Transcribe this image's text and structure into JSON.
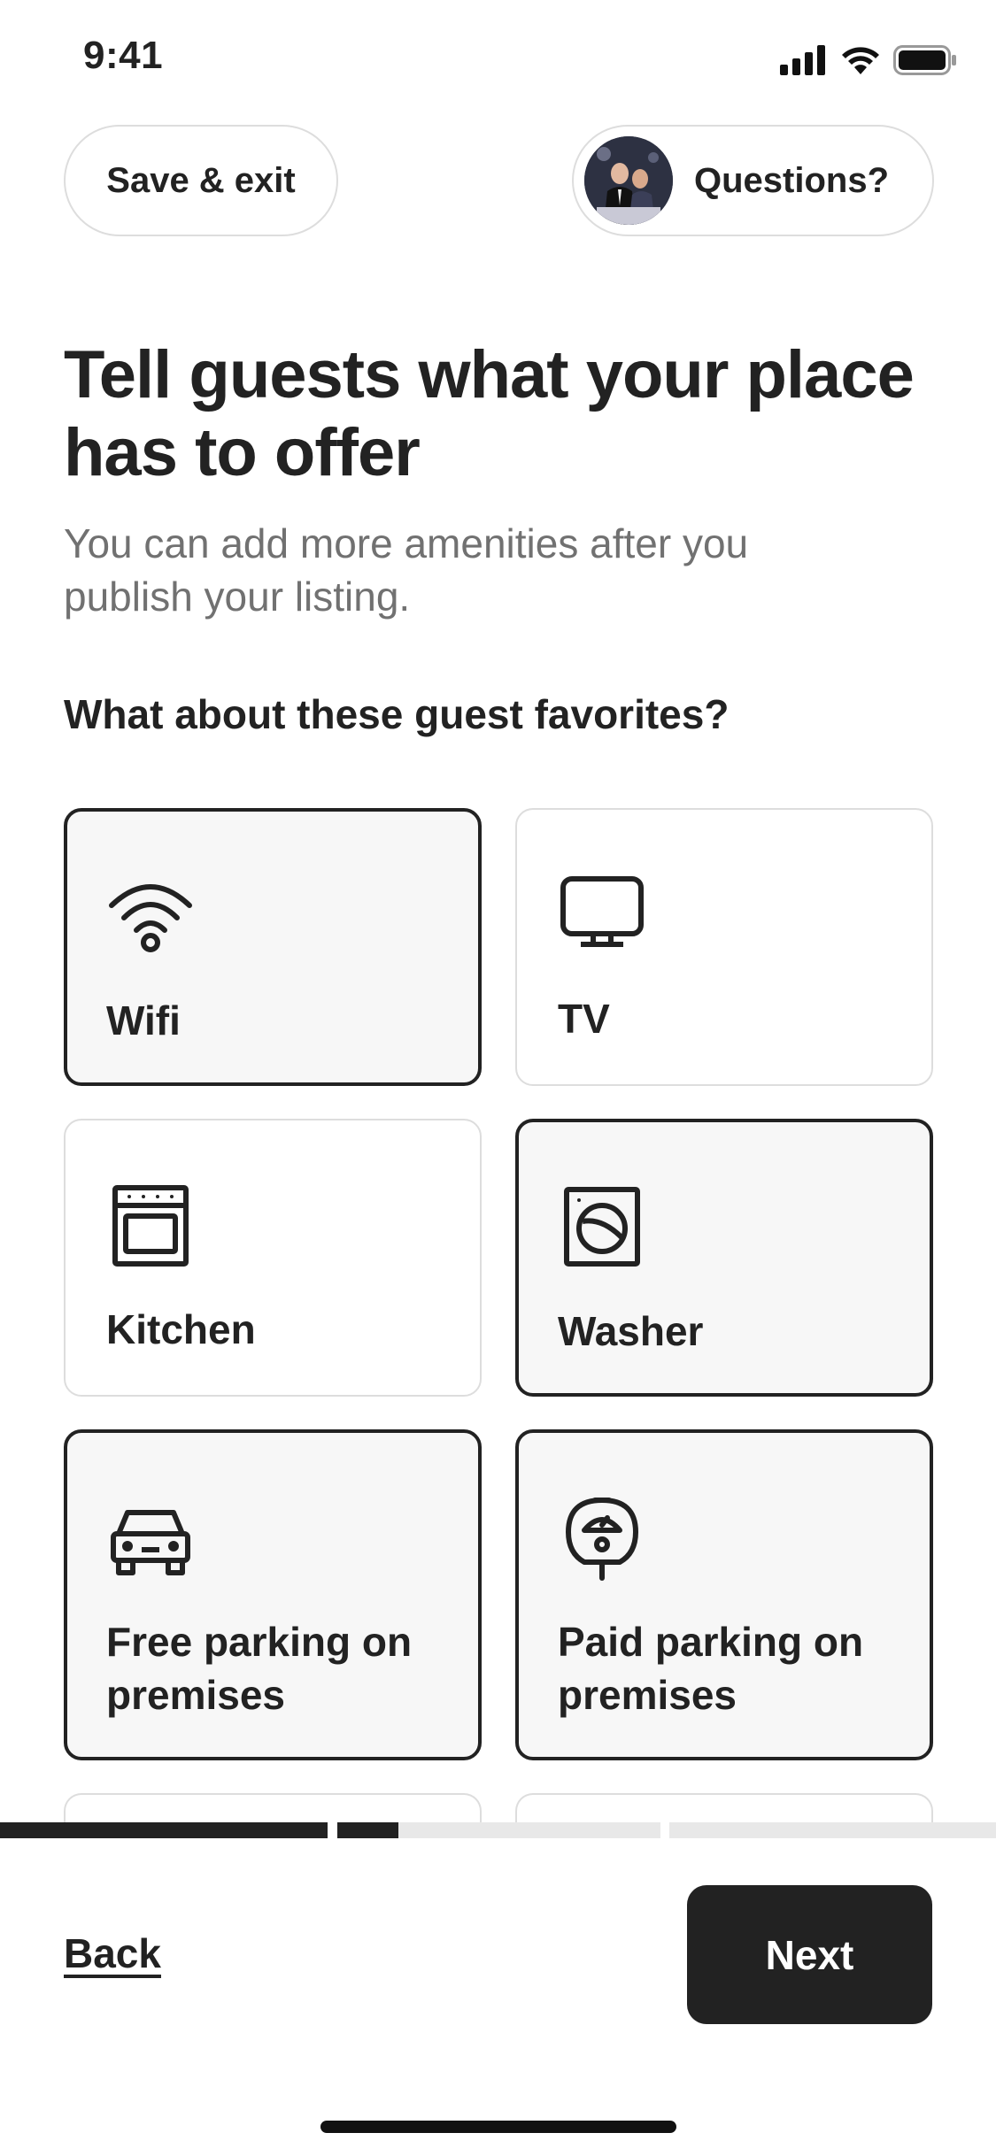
{
  "status_bar": {
    "time": "9:41"
  },
  "header": {
    "save_exit_label": "Save & exit",
    "questions_label": "Questions?"
  },
  "main": {
    "title": "Tell guests what your place has to offer",
    "subtitle": "You can add more amenities after you publish your listing.",
    "section_label": "What about these guest favorites?"
  },
  "amenities": [
    {
      "label": "Wifi",
      "icon": "wifi-icon",
      "selected": true
    },
    {
      "label": "TV",
      "icon": "tv-icon",
      "selected": false
    },
    {
      "label": "Kitchen",
      "icon": "oven-icon",
      "selected": false
    },
    {
      "label": "Washer",
      "icon": "washer-icon",
      "selected": true
    },
    {
      "label": "Free parking on premises",
      "icon": "car-icon",
      "selected": true
    },
    {
      "label": "Paid parking on premises",
      "icon": "parking-meter-icon",
      "selected": true
    }
  ],
  "progress": {
    "steps": 3,
    "completed_steps": 1,
    "current_step_fraction": 0.19
  },
  "footer": {
    "back_label": "Back",
    "next_label": "Next"
  },
  "colors": {
    "text": "#222222",
    "muted": "#717171",
    "border": "#dddddd",
    "selected_bg": "#f7f7f7",
    "progress_track": "#e8e8e8"
  }
}
